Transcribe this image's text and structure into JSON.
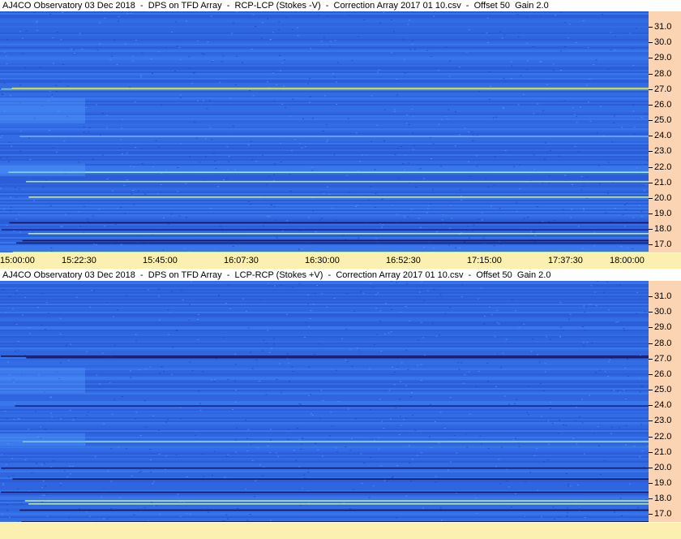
{
  "panels": [
    {
      "title": "AJ4CO Observatory 03 Dec 2018  -  DPS on TFD Array  -  RCP-LCP (Stokes -V)  -  Correction Array 2017 01 10.csv  -  Offset 50  Gain 2.0",
      "bands": [
        {
          "f": 27.1,
          "c": "#ffe14a"
        },
        {
          "f": 27.05,
          "c": "#9cf06a"
        },
        {
          "f": 24.0,
          "c": "#7fb0ff"
        },
        {
          "f": 21.7,
          "c": "#a8ffd8"
        },
        {
          "f": 21.1,
          "c": "#c8ffa0"
        },
        {
          "f": 20.1,
          "c": "#d8ff9a"
        },
        {
          "f": 18.45,
          "c": "#0a0a60"
        },
        {
          "f": 18.0,
          "c": "#1a1a80"
        },
        {
          "f": 17.75,
          "c": "#d8ff9a"
        },
        {
          "f": 17.3,
          "c": "#0a0a50"
        },
        {
          "f": 17.15,
          "c": "#0a0a50"
        },
        {
          "f": 16.55,
          "c": "#c8ffa0"
        }
      ]
    },
    {
      "title": "AJ4CO Observatory 03 Dec 2018  -  DPS on TFD Array  -  LCP-RCP (Stokes +V)  -  Correction Array 2017 01 10.csv  -  Offset 50  Gain 2.0",
      "bands": [
        {
          "f": 27.2,
          "c": "#0a0a50"
        },
        {
          "f": 27.1,
          "c": "#0a0a60"
        },
        {
          "f": 24.0,
          "c": "#0a1a80"
        },
        {
          "f": 21.7,
          "c": "#a8e8ff"
        },
        {
          "f": 20.0,
          "c": "#0a0a60"
        },
        {
          "f": 19.3,
          "c": "#0a0a60"
        },
        {
          "f": 18.45,
          "c": "#0a0a60"
        },
        {
          "f": 17.9,
          "c": "#d8ff9a"
        },
        {
          "f": 17.7,
          "c": "#c8ffa0"
        },
        {
          "f": 17.3,
          "c": "#0a0a50"
        },
        {
          "f": 16.55,
          "c": "#0a0a50"
        }
      ]
    }
  ],
  "chart_data": {
    "type": "heatmap",
    "x_tick_labels": [
      "15:00:00",
      "15:22:30",
      "15:45:00",
      "16:07:30",
      "16:30:00",
      "16:52:30",
      "17:15:00",
      "17:37:30",
      "18:00:00"
    ],
    "y_ticks": [
      17.0,
      18.0,
      19.0,
      20.0,
      21.0,
      22.0,
      23.0,
      24.0,
      25.0,
      26.0,
      27.0,
      28.0,
      29.0,
      30.0,
      31.0
    ],
    "y_tick_labels": [
      "17.0",
      "18.0",
      "19.0",
      "20.0",
      "21.0",
      "22.0",
      "23.0",
      "24.0",
      "25.0",
      "26.0",
      "27.0",
      "28.0",
      "29.0",
      "30.0",
      "31.0"
    ],
    "ylim": [
      16.5,
      32.0
    ],
    "xlim_seconds": [
      0,
      10800
    ],
    "colors": {
      "background": "#2f66e0",
      "dark": "#0a0a50",
      "bright": "#ffe14a"
    }
  }
}
